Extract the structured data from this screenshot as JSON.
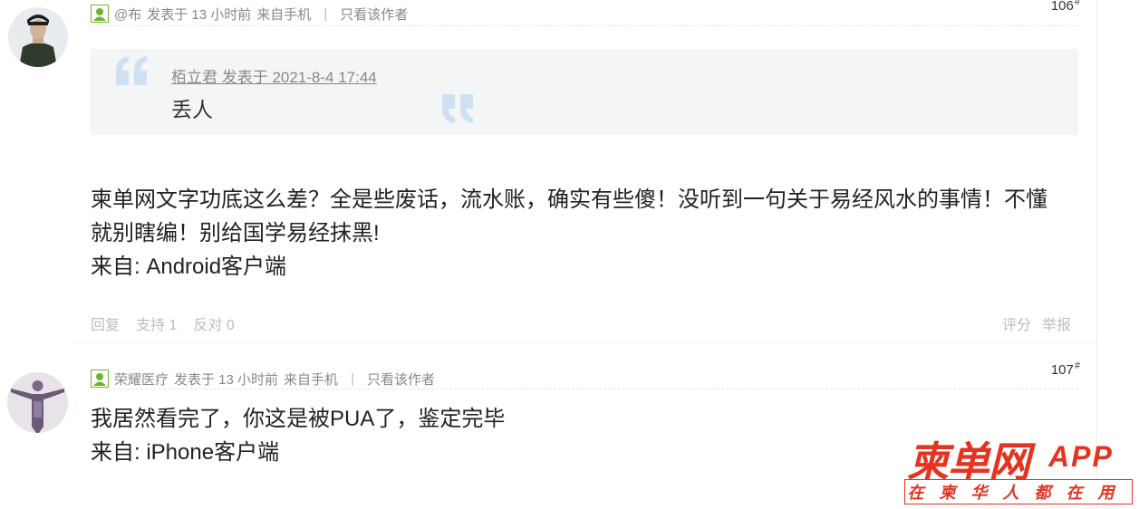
{
  "post1": {
    "author": "@布",
    "posted": "发表于 13 小时前",
    "source": "来自手机",
    "only_author": "只看该作者",
    "floor": "106",
    "floor_mark": "#",
    "quote": {
      "author_line": "栢立君 发表于 2021-8-4 17:44",
      "text": "丢人"
    },
    "content_line1": "柬单网文字功底这么差？全是些废话，流水账，确实有些傻！没听到一句关于易经风水的事情！不懂",
    "content_line2": "就别瞎编！别给国学易经抹黑!",
    "client": "来自: Android客户端",
    "reply": "回复",
    "support": "支持 1",
    "oppose": "反对 0",
    "rate": "评分",
    "report": "举报"
  },
  "post2": {
    "author": "荣耀医疗",
    "posted": "发表于 13 小时前",
    "source": "来自手机",
    "only_author": "只看该作者",
    "floor": "107",
    "floor_mark": "#",
    "content_line1": "我居然看完了，你这是被PUA了，鉴定完毕",
    "client": "来自: iPhone客户端"
  },
  "brand": {
    "logo": "柬单网",
    "app": "APP",
    "slogan": "在柬华人都在用"
  },
  "colors": {
    "brand_red": "#e4331f",
    "meta_gray": "#888888",
    "user_icon_green": "#6fb52c"
  }
}
